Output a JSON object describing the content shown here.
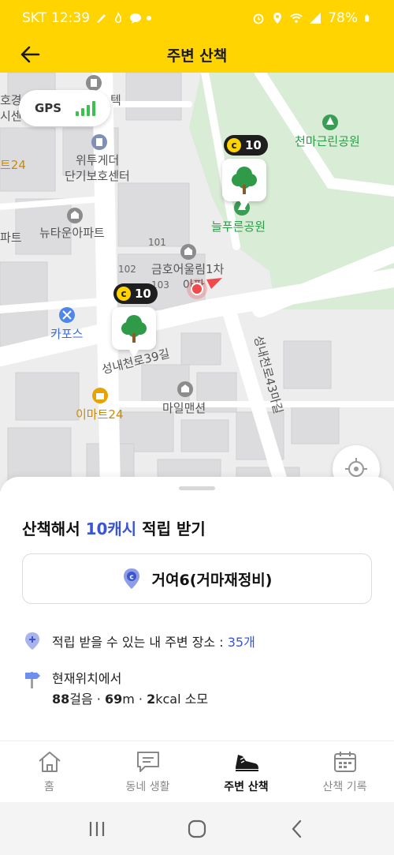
{
  "status_bar": {
    "carrier": "SKT",
    "time": "12:39",
    "battery": "78%"
  },
  "header": {
    "title": "주변 산책"
  },
  "map": {
    "gps_label": "GPS",
    "labels": {
      "store_left_top": "호경",
      "store_left_top2": "시센",
      "mart_left": "트24",
      "apt_left": "파트",
      "care_center_1": "위투게더",
      "care_center_2": "단기보호센터",
      "newtown_apt": "뉴타운아파트",
      "bldg_101": "101",
      "bldg_102": "102",
      "bldg_103": "103",
      "kumho_1": "금호어울림1차",
      "kumho_2": "아파",
      "kapos": "카포스",
      "road_39": "성내천로39길",
      "road_43": "성내천로43마길",
      "emart24": "이마트24",
      "mail_mansion": "마일맨션",
      "neulpureun_park": "늘푸른공원",
      "cheonma_park": "천마근린공원",
      "top_cut": "텍"
    },
    "markers": [
      {
        "coin_value": "10"
      },
      {
        "coin_value": "10"
      }
    ],
    "colors": {
      "park": "#d9ecd6",
      "road": "#ffffff",
      "building": "#dedee0",
      "location": "#f04a4a"
    }
  },
  "sheet": {
    "headline_prefix": "산책해서 ",
    "headline_accent": "10캐시",
    "headline_suffix": " 적립 받기",
    "place_name": "거여6(거마재정비)",
    "nearby_prefix": "적립 받을 수 있는 내 주변 장소 : ",
    "nearby_count": "35개",
    "from_here": "현재위치에서",
    "steps_num": "88",
    "steps_unit": "걸음 · ",
    "dist_num": "69",
    "dist_unit": "m · ",
    "kcal_num": "2",
    "kcal_unit": "kcal 소모"
  },
  "tabs": [
    {
      "label": "홈",
      "icon": "home-icon"
    },
    {
      "label": "동네 생활",
      "icon": "chat-icon"
    },
    {
      "label": "주변 산책",
      "icon": "shoe-icon",
      "active": true
    },
    {
      "label": "산책 기록",
      "icon": "calendar-icon"
    }
  ],
  "accent_color": "#FFD400",
  "link_color": "#3a56d4"
}
